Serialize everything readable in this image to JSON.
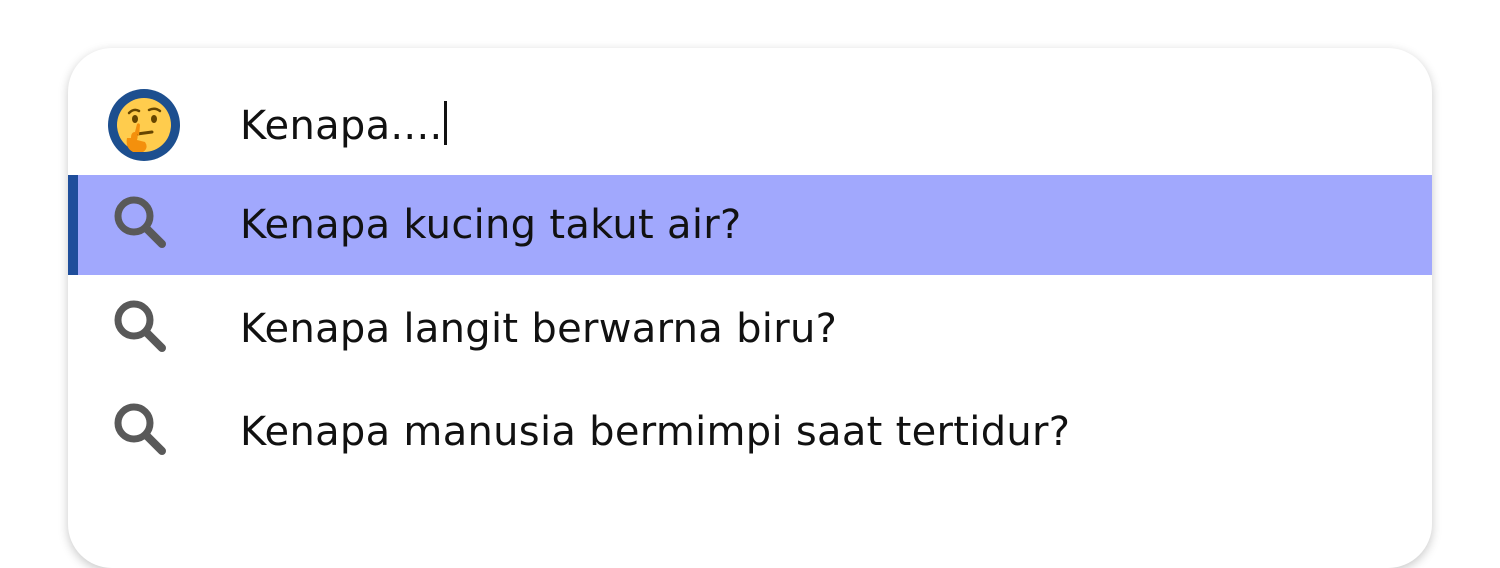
{
  "search": {
    "query": "Kenapa....",
    "avatar_icon": "thinking-face-emoji-icon"
  },
  "suggestions": [
    {
      "label": "Kenapa kucing takut air?",
      "icon": "search-icon",
      "selected": true
    },
    {
      "label": "Kenapa langit berwarna biru?",
      "icon": "search-icon",
      "selected": false
    },
    {
      "label": "Kenapa manusia bermimpi saat tertidur?",
      "icon": "search-icon",
      "selected": false
    }
  ],
  "colors": {
    "selected_background": "#a1a8fd",
    "selected_bar": "#1f4e9b",
    "avatar_ring": "#1d4f8f",
    "icon_gray": "#595959"
  }
}
